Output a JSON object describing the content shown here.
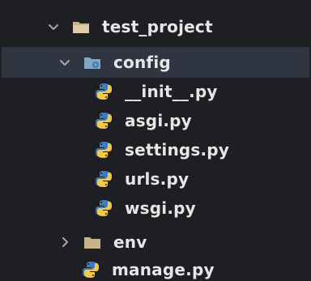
{
  "colors": {
    "background": "#1e1f22",
    "selected_row": "#2f3541",
    "text": "#e6e6e6",
    "folder": "#c9b48a",
    "folder_config": "#7fa7c9",
    "python_blue": "#3b7bbf",
    "python_yellow": "#f2c94c",
    "chevron": "#a7a7a7"
  },
  "tree": {
    "items": [
      {
        "label": "test_project",
        "type": "folder",
        "expanded": true,
        "icon": "folder-open-icon"
      },
      {
        "label": "config",
        "type": "folder",
        "expanded": true,
        "icon": "folder-config-icon",
        "selected": true
      },
      {
        "label": "__init__.py",
        "type": "file",
        "icon": "python-icon"
      },
      {
        "label": "asgi.py",
        "type": "file",
        "icon": "python-icon"
      },
      {
        "label": "settings.py",
        "type": "file",
        "icon": "python-icon"
      },
      {
        "label": "urls.py",
        "type": "file",
        "icon": "python-icon"
      },
      {
        "label": "wsgi.py",
        "type": "file",
        "icon": "python-icon"
      },
      {
        "label": "env",
        "type": "folder",
        "expanded": false,
        "icon": "folder-icon"
      },
      {
        "label": "manage.py",
        "type": "file",
        "icon": "python-icon"
      }
    ]
  }
}
